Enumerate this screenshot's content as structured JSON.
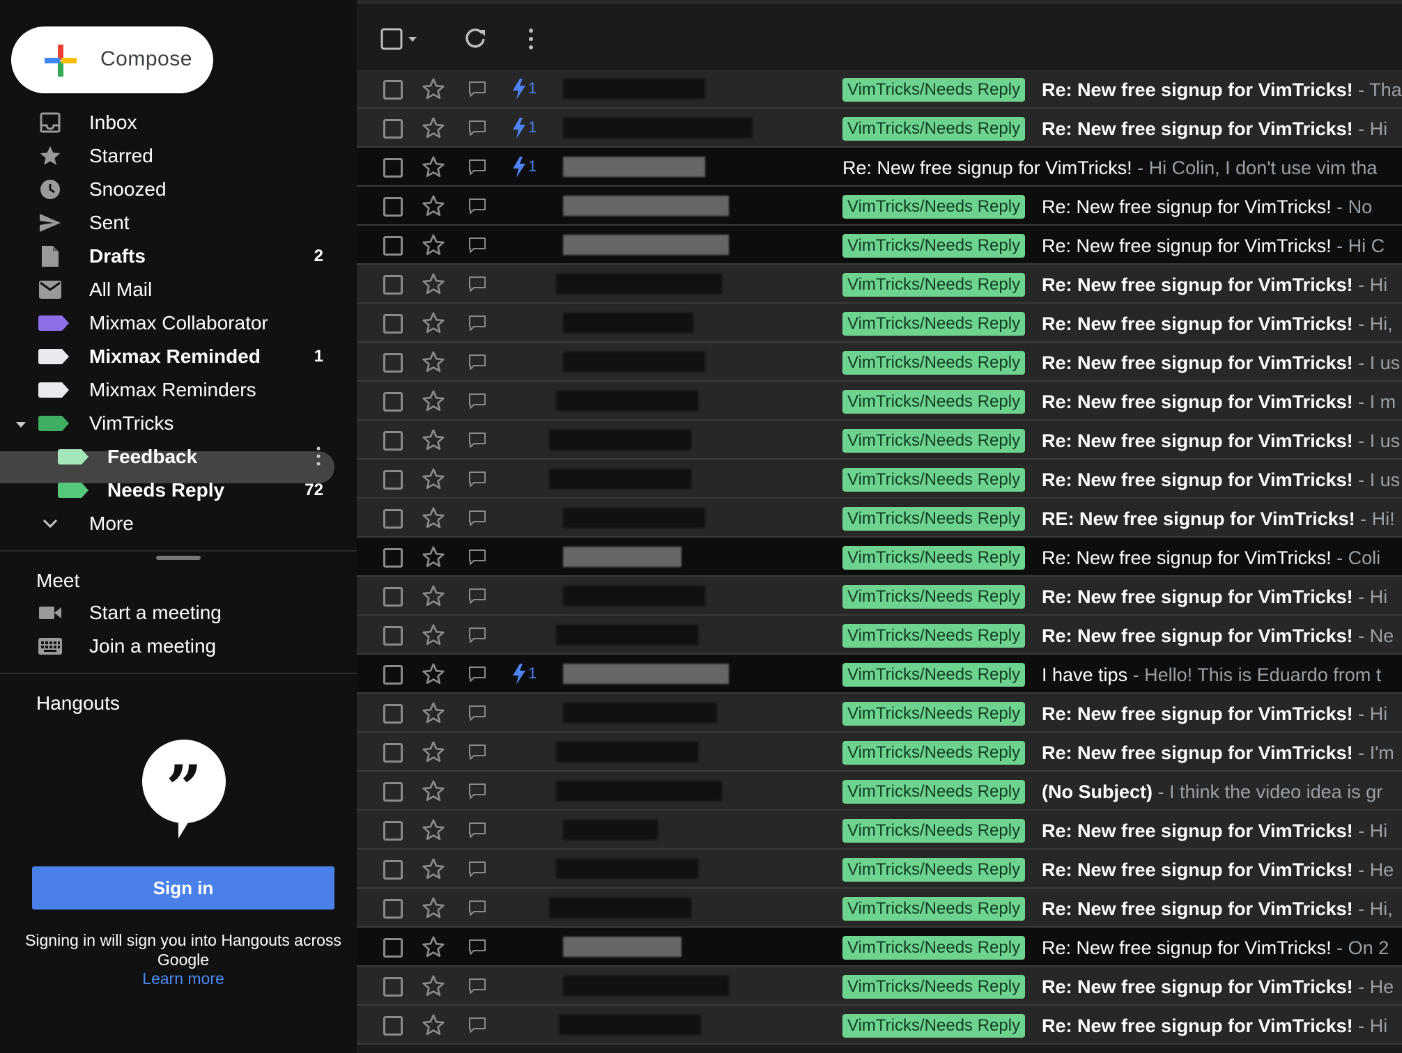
{
  "sidebar": {
    "compose": "Compose",
    "nav": [
      {
        "label": "Inbox",
        "count": "",
        "icon": "inbox-icon"
      },
      {
        "label": "Starred",
        "count": "",
        "icon": "star-icon"
      },
      {
        "label": "Snoozed",
        "count": "",
        "icon": "clock-icon"
      },
      {
        "label": "Sent",
        "count": "",
        "icon": "send-icon"
      },
      {
        "label": "Drafts",
        "count": "2",
        "icon": "draft-icon"
      },
      {
        "label": "All Mail",
        "count": "",
        "icon": "mail-icon"
      },
      {
        "label": "Mixmax Collaborator",
        "count": "",
        "icon": "label-icon",
        "color": "#8d6ee8"
      },
      {
        "label": "Mixmax Reminded",
        "count": "1",
        "icon": "label-icon",
        "color": "#e8eaed"
      },
      {
        "label": "Mixmax Reminders",
        "count": "",
        "icon": "label-icon",
        "color": "#e8eaed"
      },
      {
        "label": "VimTricks",
        "count": "",
        "icon": "label-icon",
        "color": "#3fae63"
      },
      {
        "label": "Feedback",
        "count": "",
        "icon": "label-icon",
        "color": "#a6e6bb"
      },
      {
        "label": "Needs Reply",
        "count": "72",
        "icon": "label-icon",
        "color": "#55c97b"
      },
      {
        "label": "More",
        "count": "",
        "icon": "chevron-down-icon"
      }
    ],
    "meet": {
      "title": "Meet",
      "start": "Start a meeting",
      "join": "Join a meeting"
    },
    "hangouts": {
      "title": "Hangouts",
      "sign_in": "Sign in",
      "note": "Signing in will sign you into Hangouts across Google",
      "learn_more": "Learn more"
    }
  },
  "colors": {
    "tag_bg": "#6ed38f",
    "bolt": "#4f82f2",
    "read_row": "#272727",
    "unread_row": "#0d0d0d"
  },
  "emails": [
    {
      "sender": "████████████",
      "thread": "1",
      "tag": "VimTricks/Needs Reply",
      "subject": "Re: New free signup for VimTricks!",
      "snippet": " - Tha",
      "bold": true,
      "unread": false
    },
    {
      "sender": "████████████████",
      "thread": "1",
      "tag": "VimTricks/Needs Reply",
      "subject": "Re: New free signup for VimTricks!",
      "snippet": " - Hi",
      "bold": true,
      "unread": false
    },
    {
      "sender": "████████████",
      "thread": "1",
      "tag": "",
      "subject": "Re: New free signup for VimTricks!",
      "snippet": " - Hi Colin, I don't use vim tha",
      "bold": false,
      "unread": true
    },
    {
      "sender": "██████████████",
      "thread": "",
      "tag": "VimTricks/Needs Reply",
      "subject": "Re: New free signup for VimTricks!",
      "snippet": " - No",
      "bold": false,
      "unread": true
    },
    {
      "sender": "██████████████",
      "thread": "",
      "tag": "VimTricks/Needs Reply",
      "subject": "Re: New free signup for VimTricks!",
      "snippet": " - Hi C",
      "bold": false,
      "unread": true
    },
    {
      "sender": "██████████████",
      "thread": "",
      "tag": "VimTricks/Needs Reply",
      "subject": "Re: New free signup for VimTricks!",
      "snippet": " - Hi",
      "bold": true,
      "unread": false
    },
    {
      "sender": "███████████",
      "thread": "",
      "tag": "VimTricks/Needs Reply",
      "subject": "Re: New free signup for VimTricks!",
      "snippet": " - Hi,",
      "bold": true,
      "unread": false
    },
    {
      "sender": "████████████",
      "thread": "",
      "tag": "VimTricks/Needs Reply",
      "subject": "Re: New free signup for VimTricks!",
      "snippet": " - I us",
      "bold": true,
      "unread": false
    },
    {
      "sender": "████████████",
      "thread": "",
      "tag": "VimTricks/Needs Reply",
      "subject": "Re: New free signup for VimTricks!",
      "snippet": " - I m",
      "bold": true,
      "unread": false
    },
    {
      "sender": "████████████",
      "thread": "",
      "tag": "VimTricks/Needs Reply",
      "subject": "Re: New free signup for VimTricks!",
      "snippet": " - I us",
      "bold": true,
      "unread": false
    },
    {
      "sender": "████████████",
      "thread": "",
      "tag": "VimTricks/Needs Reply",
      "subject": "Re: New free signup for VimTricks!",
      "snippet": " - I us",
      "bold": true,
      "unread": false
    },
    {
      "sender": "████████████",
      "thread": "",
      "tag": "VimTricks/Needs Reply",
      "subject": "RE: New free signup for VimTricks!",
      "snippet": " - Hi!",
      "bold": true,
      "unread": false
    },
    {
      "sender": "██████████",
      "thread": "",
      "tag": "VimTricks/Needs Reply",
      "subject": "Re: New free signup for VimTricks!",
      "snippet": " - Coli",
      "bold": false,
      "unread": true
    },
    {
      "sender": "████████████",
      "thread": "",
      "tag": "VimTricks/Needs Reply",
      "subject": "Re: New free signup for VimTricks!",
      "snippet": " - Hi",
      "bold": true,
      "unread": false
    },
    {
      "sender": "████████████",
      "thread": "",
      "tag": "VimTricks/Needs Reply",
      "subject": "Re: New free signup for VimTricks!",
      "snippet": " - Ne",
      "bold": true,
      "unread": false
    },
    {
      "sender": "██████████████",
      "thread": "1",
      "tag": "VimTricks/Needs Reply",
      "subject": "I have tips",
      "snippet": " - Hello! This is Eduardo from t",
      "bold": false,
      "unread": true
    },
    {
      "sender": "█████████████",
      "thread": "",
      "tag": "VimTricks/Needs Reply",
      "subject": "Re: New free signup for VimTricks!",
      "snippet": " - Hi",
      "bold": true,
      "unread": false
    },
    {
      "sender": "████████████",
      "thread": "",
      "tag": "VimTricks/Needs Reply",
      "subject": "Re: New free signup for VimTricks!",
      "snippet": " - I'm",
      "bold": true,
      "unread": false
    },
    {
      "sender": "██████████████",
      "thread": "",
      "tag": "VimTricks/Needs Reply",
      "subject": "(No Subject)",
      "snippet": " - I think the video idea is gr",
      "bold": true,
      "unread": false
    },
    {
      "sender": "████████",
      "thread": "",
      "tag": "VimTricks/Needs Reply",
      "subject": "Re: New free signup for VimTricks!",
      "snippet": " - Hi",
      "bold": true,
      "unread": false
    },
    {
      "sender": "████████████",
      "thread": "",
      "tag": "VimTricks/Needs Reply",
      "subject": "Re: New free signup for VimTricks!",
      "snippet": " - He",
      "bold": true,
      "unread": false
    },
    {
      "sender": "████████████",
      "thread": "",
      "tag": "VimTricks/Needs Reply",
      "subject": "Re: New free signup for VimTricks!",
      "snippet": " - Hi,",
      "bold": true,
      "unread": false
    },
    {
      "sender": "██████████",
      "thread": "",
      "tag": "VimTricks/Needs Reply",
      "subject": "Re: New free signup for VimTricks!",
      "snippet": " - On 2",
      "bold": false,
      "unread": true
    },
    {
      "sender": "██████████████",
      "thread": "",
      "tag": "VimTricks/Needs Reply",
      "subject": "Re: New free signup for VimTricks!",
      "snippet": " - He",
      "bold": true,
      "unread": false
    },
    {
      "sender": "████████████",
      "thread": "",
      "tag": "VimTricks/Needs Reply",
      "subject": "Re: New free signup for VimTricks!",
      "snippet": " - Hi",
      "bold": true,
      "unread": false
    }
  ]
}
